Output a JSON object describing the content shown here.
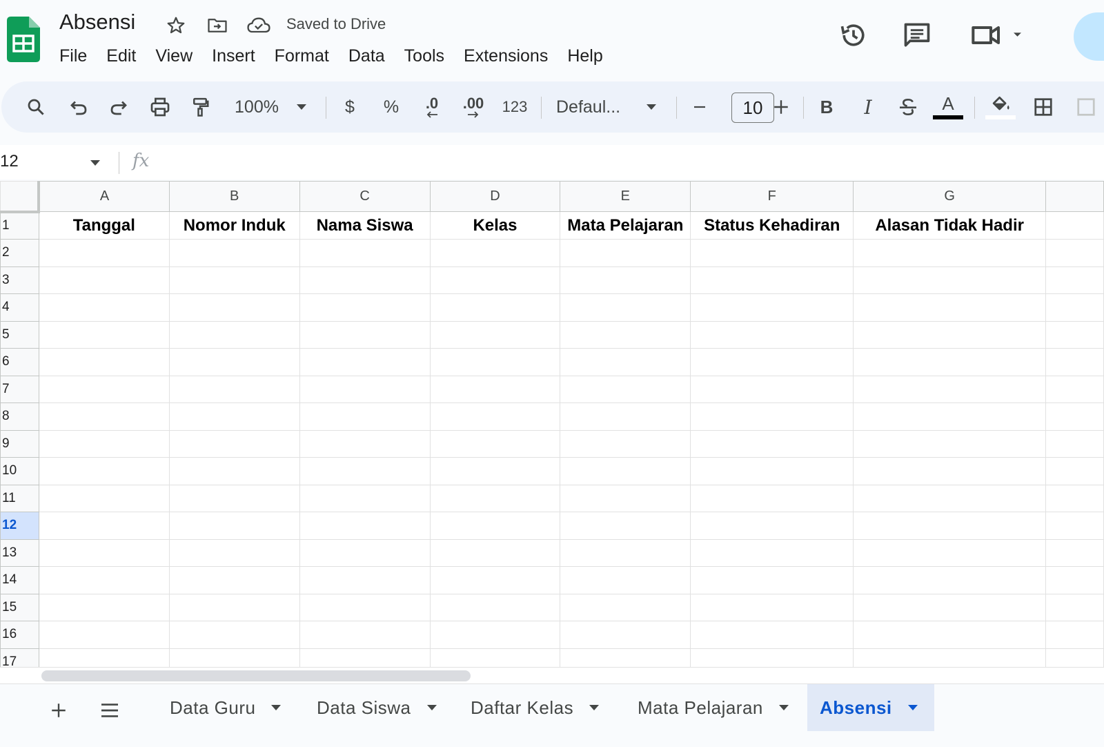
{
  "app": {
    "doc_title": "Absensi",
    "save_status": "Saved to Drive",
    "brand_color": "#0f9d58",
    "accent_color": "#0b57d0"
  },
  "menu": [
    "File",
    "Edit",
    "View",
    "Insert",
    "Format",
    "Data",
    "Tools",
    "Extensions",
    "Help"
  ],
  "toolbar": {
    "zoom": "100%",
    "currency": "$",
    "percent": "%",
    "decrease_decimal": ".0",
    "increase_decimal": ".00",
    "number_format": "123",
    "font": "Defaul...",
    "font_size": "10",
    "bold": "B",
    "italic": "I",
    "text_color_letter": "A",
    "icons": [
      "search-icon",
      "undo-icon",
      "redo-icon",
      "print-icon",
      "paint-format-icon",
      "strikethrough-icon",
      "fill-color-icon",
      "borders-icon"
    ]
  },
  "formula_bar": {
    "name_box": "12",
    "fx": "fx",
    "formula": ""
  },
  "sheet": {
    "columns": [
      "A",
      "B",
      "C",
      "D",
      "E",
      "F",
      "G"
    ],
    "rows": [
      "1",
      "2",
      "3",
      "4",
      "5",
      "6",
      "7",
      "8",
      "9",
      "10",
      "11",
      "12",
      "13",
      "14",
      "15",
      "16",
      "17"
    ],
    "selected_row": "12",
    "header_row": [
      "Tanggal",
      "Nomor Induk",
      "Nama Siswa",
      "Kelas",
      "Mata Pelajaran",
      "Status Kehadiran",
      "Alasan Tidak Hadir"
    ]
  },
  "tabs": {
    "sheets": [
      {
        "label": "Data Guru",
        "active": false
      },
      {
        "label": "Data Siswa",
        "active": false
      },
      {
        "label": "Daftar Kelas",
        "active": false
      },
      {
        "label": "Mata Pelajaran",
        "active": false
      },
      {
        "label": "Absensi",
        "active": true
      }
    ]
  }
}
